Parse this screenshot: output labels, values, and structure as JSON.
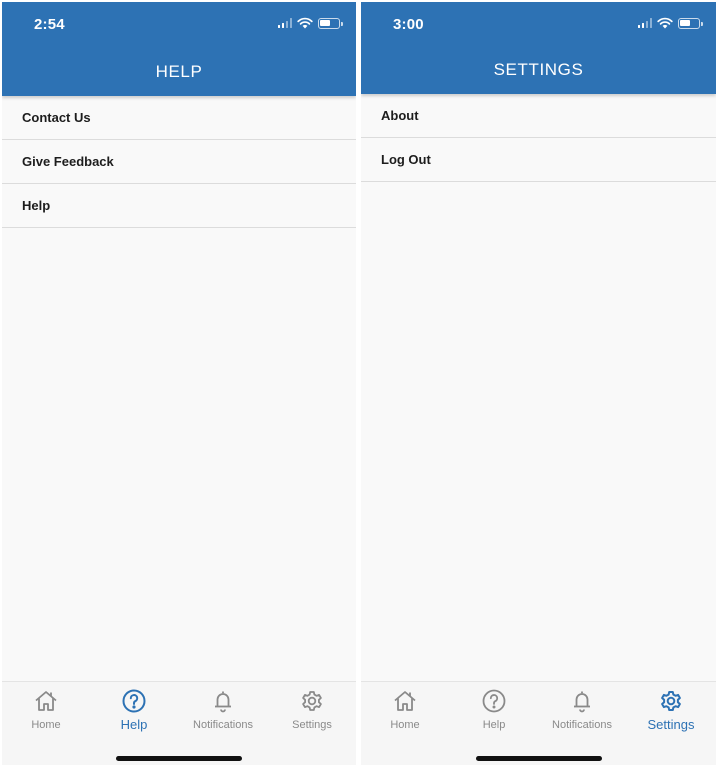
{
  "screens": [
    {
      "status": {
        "time": "2:54"
      },
      "header": {
        "title": "HELP"
      },
      "menu": [
        {
          "label": "Contact Us"
        },
        {
          "label": "Give Feedback"
        },
        {
          "label": "Help"
        }
      ],
      "tabs": [
        {
          "label": "Home",
          "icon": "home-icon"
        },
        {
          "label": "Help",
          "icon": "help-circle-icon",
          "active": true
        },
        {
          "label": "Notifications",
          "icon": "bell-icon"
        },
        {
          "label": "Settings",
          "icon": "gear-icon"
        }
      ]
    },
    {
      "status": {
        "time": "3:00"
      },
      "header": {
        "title": "SETTINGS"
      },
      "menu": [
        {
          "label": "About"
        },
        {
          "label": "Log Out"
        }
      ],
      "tabs": [
        {
          "label": "Home",
          "icon": "home-icon"
        },
        {
          "label": "Help",
          "icon": "help-circle-icon"
        },
        {
          "label": "Notifications",
          "icon": "bell-icon"
        },
        {
          "label": "Settings",
          "icon": "gear-icon",
          "active": true
        }
      ]
    }
  ],
  "colors": {
    "header": "#2d72b4",
    "active_tab": "#2d72b4",
    "inactive_tab": "#8a8a8a",
    "background": "#f9f9f9"
  }
}
